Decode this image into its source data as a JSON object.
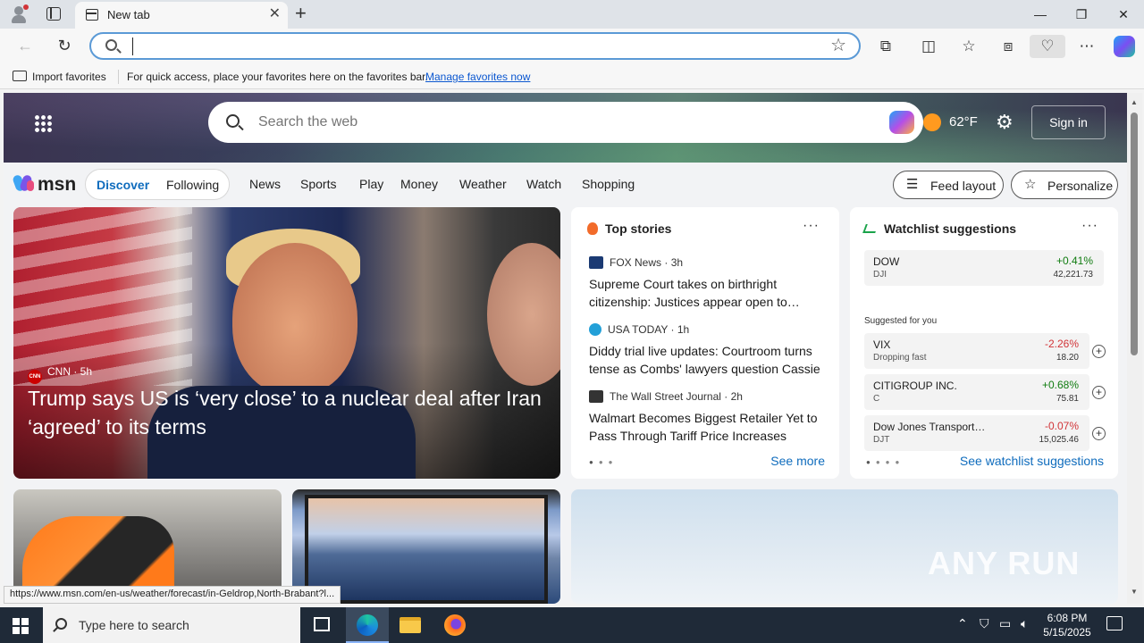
{
  "browser": {
    "tab_title": "New tab",
    "address_value": "",
    "favorites_bar": {
      "import_label": "Import favorites",
      "message": "For quick access, place your favorites here on the favorites bar.",
      "manage_link": "Manage favorites now"
    }
  },
  "msn": {
    "search_placeholder": "Search the web",
    "weather_temp": "62°F",
    "sign_in": "Sign in",
    "logo_text": "msn",
    "segments": [
      "Discover",
      "Following"
    ],
    "categories": [
      "News",
      "Sports",
      "Play",
      "Money",
      "Weather",
      "Watch",
      "Shopping"
    ],
    "feed_layout": "Feed layout",
    "personalize": "Personalize",
    "hero": {
      "source": "CNN",
      "source_badge": "CNN",
      "age": "5h",
      "title": "Trump says US is ‘very close’ to a nuclear deal after Iran ‘agreed’ to its terms"
    },
    "top_stories": {
      "heading": "Top stories",
      "items": [
        {
          "source": "FOX News",
          "age": "3h",
          "title": "Supreme Court takes on birthright citizenship: Justices appear open to…"
        },
        {
          "source": "USA TODAY",
          "age": "1h",
          "title": "Diddy trial live updates: Courtroom turns tense as Combs' lawyers question Cassie"
        },
        {
          "source": "The Wall Street Journal",
          "age": "2h",
          "title": "Walmart Becomes Biggest Retailer Yet to Pass Through Tariff Price Increases"
        }
      ],
      "see_more": "See more"
    },
    "watchlist": {
      "heading": "Watchlist suggestions",
      "main": {
        "name": "DOW",
        "symbol": "DJI",
        "change": "+0.41%",
        "price": "42,221.73"
      },
      "suggested_label": "Suggested for you",
      "suggested": [
        {
          "name": "VIX",
          "symbol": "Dropping fast",
          "change": "-2.26%",
          "price": "18.20"
        },
        {
          "name": "CITIGROUP INC.",
          "symbol": "C",
          "change": "+0.68%",
          "price": "75.81"
        },
        {
          "name": "Dow Jones Transport…",
          "symbol": "DJT",
          "change": "-0.07%",
          "price": "15,025.46"
        }
      ],
      "see_link": "See watchlist suggestions"
    },
    "status_url": "https://www.msn.com/en-us/weather/forecast/in-Geldrop,North-Brabant?l...",
    "watermark": "ANY RUN"
  },
  "taskbar": {
    "search_placeholder": "Type here to search",
    "time": "6:08 PM",
    "date": "5/15/2025"
  },
  "colors": {
    "accent": "#0f6cbd",
    "positive": "#107c10",
    "negative": "#d13438"
  }
}
